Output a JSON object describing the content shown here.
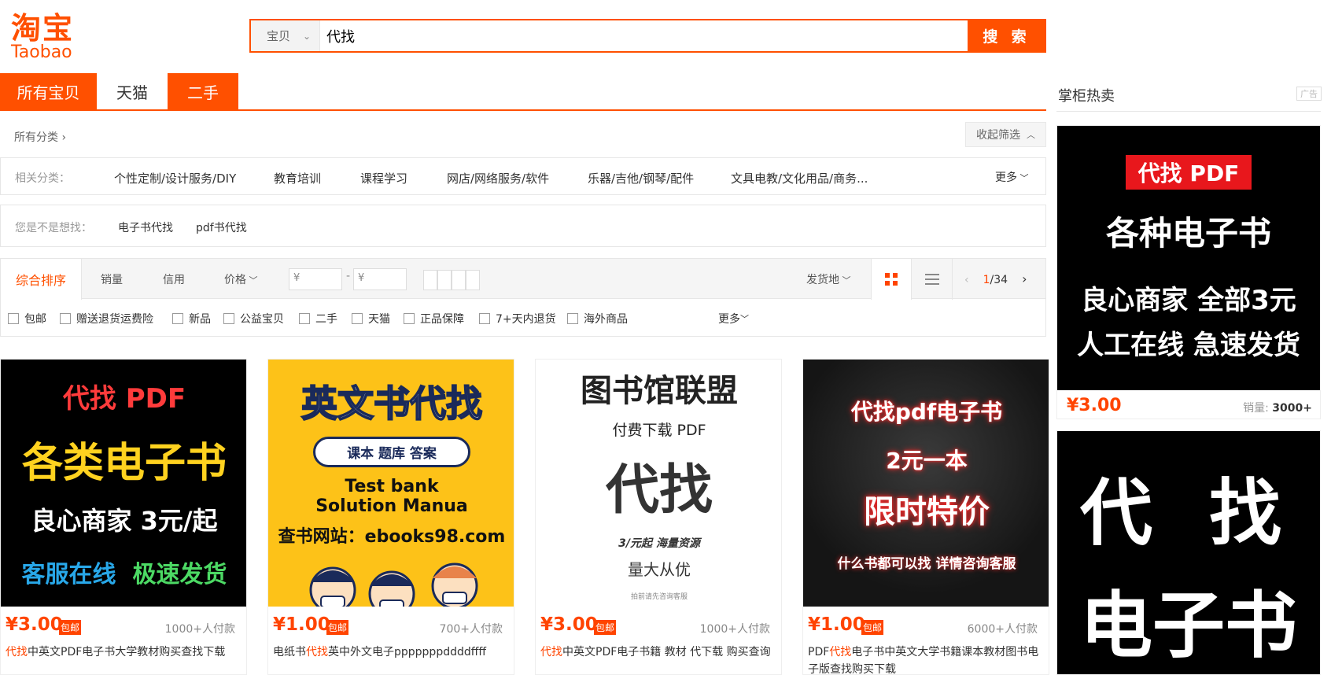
{
  "logo": {
    "cn": "淘宝",
    "en": "Taobao"
  },
  "search": {
    "type_label": "宝贝",
    "query": "代找",
    "button_label": "搜 索"
  },
  "tabs": [
    "所有宝贝",
    "天猫",
    "二手"
  ],
  "category_row": {
    "label": "所有分类",
    "collapse_label": "收起筛选"
  },
  "related": {
    "label": "相关分类：",
    "items": [
      "个性定制/设计服务/DIY",
      "教育培训",
      "课程学习",
      "网店/网络服务/软件",
      "乐器/吉他/钢琴/配件",
      "文具电教/文化用品/商务..."
    ],
    "more": "更多"
  },
  "suggest": {
    "label": "您是不是想找：",
    "items": [
      "电子书代找",
      "pdf书代找"
    ]
  },
  "sort": {
    "items": [
      "综合排序",
      "销量",
      "信用",
      "价格"
    ],
    "price_min_placeholder": "¥",
    "price_max_placeholder": "¥",
    "location": "发货地",
    "pager_current": "1",
    "pager_total": "/34"
  },
  "checks": [
    "包邮",
    "赠送退货运费险",
    "新品",
    "公益宝贝",
    "二手",
    "天猫",
    "正品保障",
    "7+天内退货",
    "海外商品"
  ],
  "checks_more": "更多",
  "products": [
    {
      "price": "¥3.00",
      "free": "包邮",
      "sold": "1000+人付款",
      "title_hl": "代找",
      "title_rest": "中英文PDF电子书大学教材购买查找下载",
      "img": {
        "l1": "代找 PDF",
        "l2": "各类电子书",
        "l3": "良心商家 3元/起",
        "l4a": "客服在线",
        "l4b": "极速发货"
      }
    },
    {
      "price": "¥1.00",
      "free": "包邮",
      "sold": "700+人付款",
      "title_pre": "电纸书",
      "title_hl": "代找",
      "title_rest": "英中外文电子pppppppddddffff",
      "img": {
        "l1": "英文书代找",
        "l2": "课本 题库 答案",
        "l3": "Test bank",
        "l4": "Solution Manua",
        "l5": "查书网站：ebooks98.com"
      }
    },
    {
      "price": "¥3.00",
      "free": "包邮",
      "sold": "1000+人付款",
      "title_hl": "代找",
      "title_rest": "中英文PDF电子书籍 教材 代下载 购买查询",
      "img": {
        "l1": "图书馆联盟",
        "l2": "付费下载 PDF",
        "l3": "代找",
        "l4": "3/元起  海量资源",
        "l5": "量大从优",
        "l6": "拍前请先咨询客服"
      }
    },
    {
      "price": "¥1.00",
      "free": "包邮",
      "sold": "6000+人付款",
      "title_pre": "PDF",
      "title_hl": "代找",
      "title_rest": "电子书中英文大学书籍课本教材图书电子版查找购买下载",
      "img": {
        "l1": "代找pdf电子书",
        "l2": "2元一本",
        "l3": "限时特价",
        "l4": "什么书都可以找 详情咨询客服"
      }
    }
  ],
  "sidebar": {
    "title": "掌柜热卖",
    "ad": "广告",
    "item1": {
      "l1": "代找 PDF",
      "l2": "各种电子书",
      "l3": "良心商家 全部3元",
      "l4": "人工在线 急速发货",
      "price": "¥3.00",
      "sales_label": "销量:",
      "sales_value": "3000+"
    },
    "item2": {
      "l1": "代 找",
      "l2": "电子书"
    }
  }
}
